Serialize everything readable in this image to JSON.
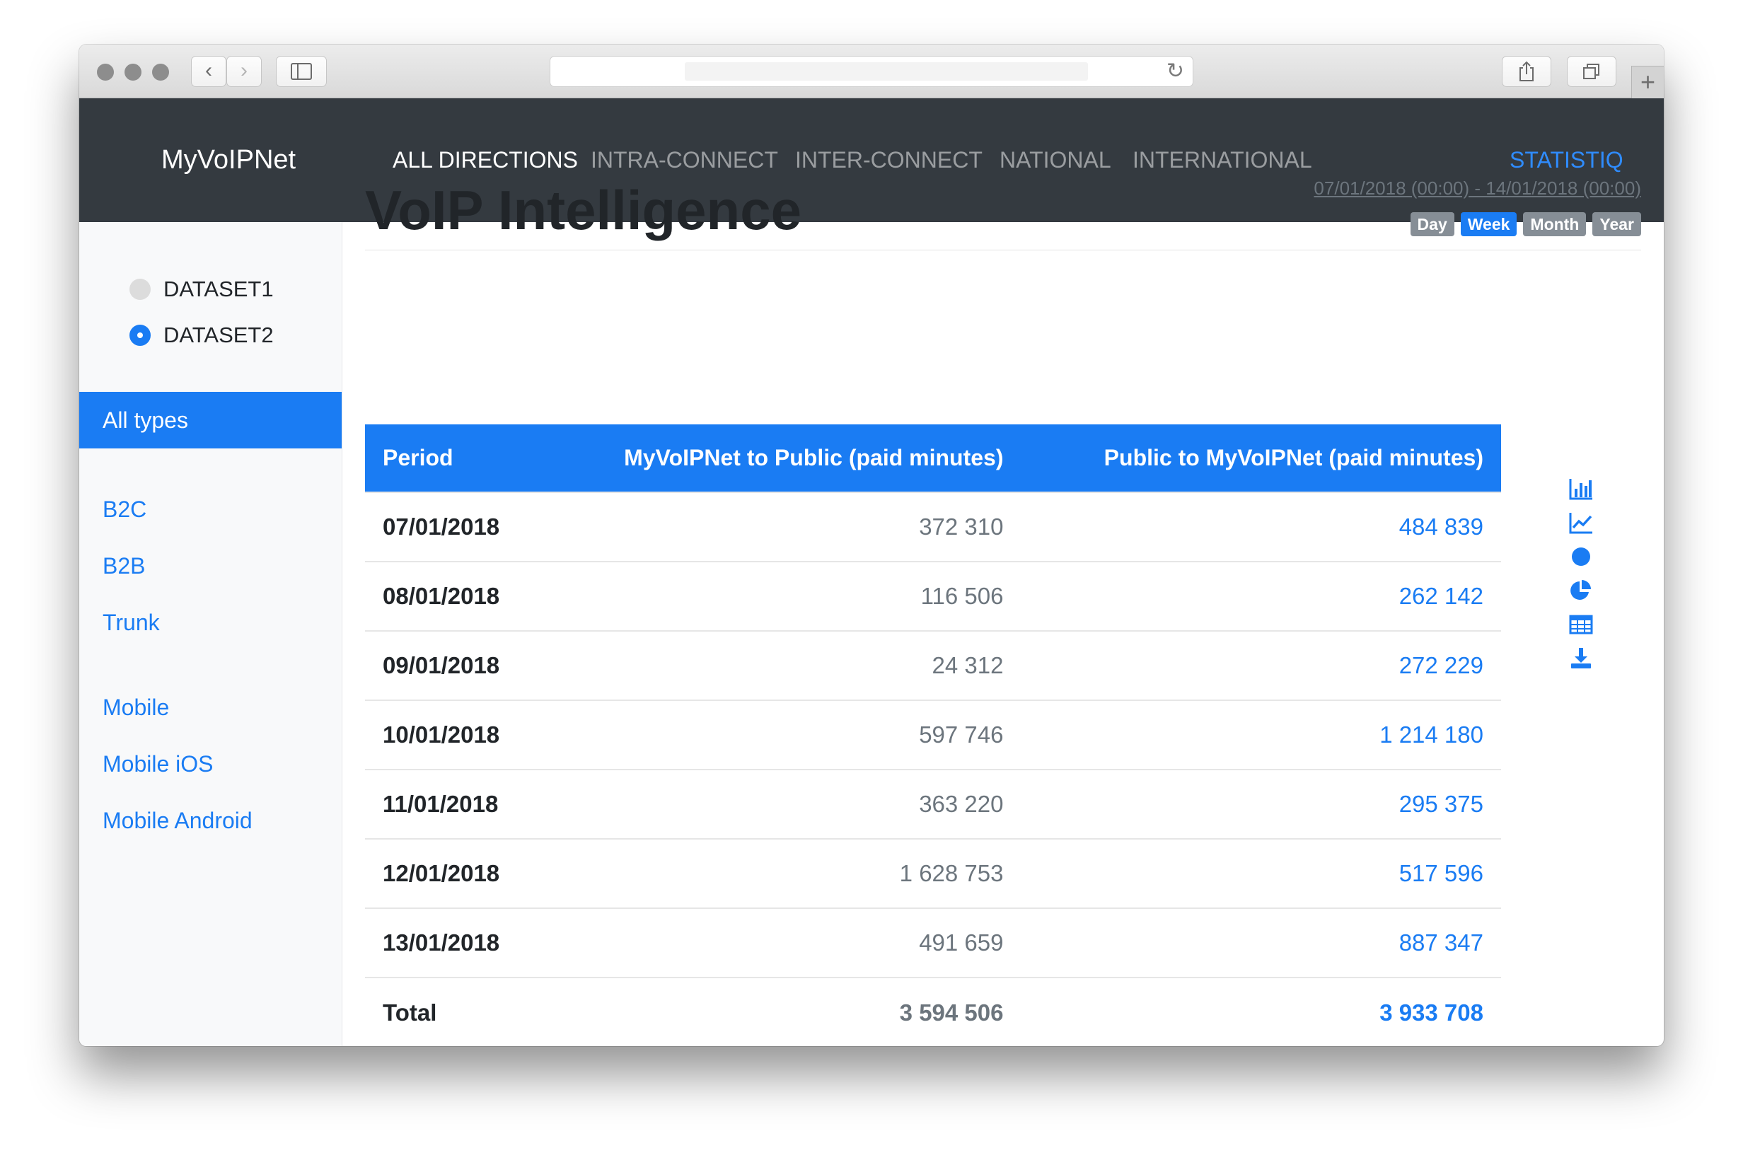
{
  "app": {
    "brand": "MyVoIPNet",
    "nav": [
      {
        "label": "ALL DIRECTIONS",
        "active": true
      },
      {
        "label": "INTRA-CONNECT",
        "active": false
      },
      {
        "label": "INTER-CONNECT",
        "active": false
      },
      {
        "label": "NATIONAL",
        "active": false
      },
      {
        "label": "INTERNATIONAL",
        "active": false
      }
    ],
    "nav_right": "STATISTIQ"
  },
  "sidebar": {
    "datasets": [
      {
        "label": "DATASET1",
        "checked": false
      },
      {
        "label": "DATASET2",
        "checked": true
      }
    ],
    "active_type": "All types",
    "groups": [
      [
        "B2C",
        "B2B",
        "Trunk"
      ],
      [
        "Mobile",
        "Mobile iOS",
        "Mobile Android"
      ]
    ]
  },
  "header": {
    "title": "VoIP Intelligence",
    "date_range": "07/01/2018 (00:00) - 14/01/2018 (00:00)",
    "periods": [
      {
        "label": "Day",
        "active": false
      },
      {
        "label": "Week",
        "active": true
      },
      {
        "label": "Month",
        "active": false
      },
      {
        "label": "Year",
        "active": false
      }
    ]
  },
  "table": {
    "columns": [
      "Period",
      "MyVoIPNet to Public (paid minutes)",
      "Public to MyVoIPNet (paid minutes)"
    ],
    "rows": [
      [
        "07/01/2018",
        "372 310",
        "484 839"
      ],
      [
        "08/01/2018",
        "116 506",
        "262 142"
      ],
      [
        "09/01/2018",
        "24 312",
        "272 229"
      ],
      [
        "10/01/2018",
        "597 746",
        "1 214 180"
      ],
      [
        "11/01/2018",
        "363 220",
        "295 375"
      ],
      [
        "12/01/2018",
        "1 628 753",
        "517 596"
      ],
      [
        "13/01/2018",
        "491 659",
        "887 347"
      ]
    ],
    "total": [
      "Total",
      "3 594 506",
      "3 933 708"
    ]
  },
  "toolbar_icons": [
    "bar-chart-icon",
    "line-chart-icon",
    "circle-icon",
    "pie-chart-icon",
    "table-icon",
    "download-icon"
  ],
  "colors": {
    "accent": "#1a7cf3",
    "navbar": "#343a40",
    "muted": "#6c757d",
    "badge": "#868e96"
  }
}
